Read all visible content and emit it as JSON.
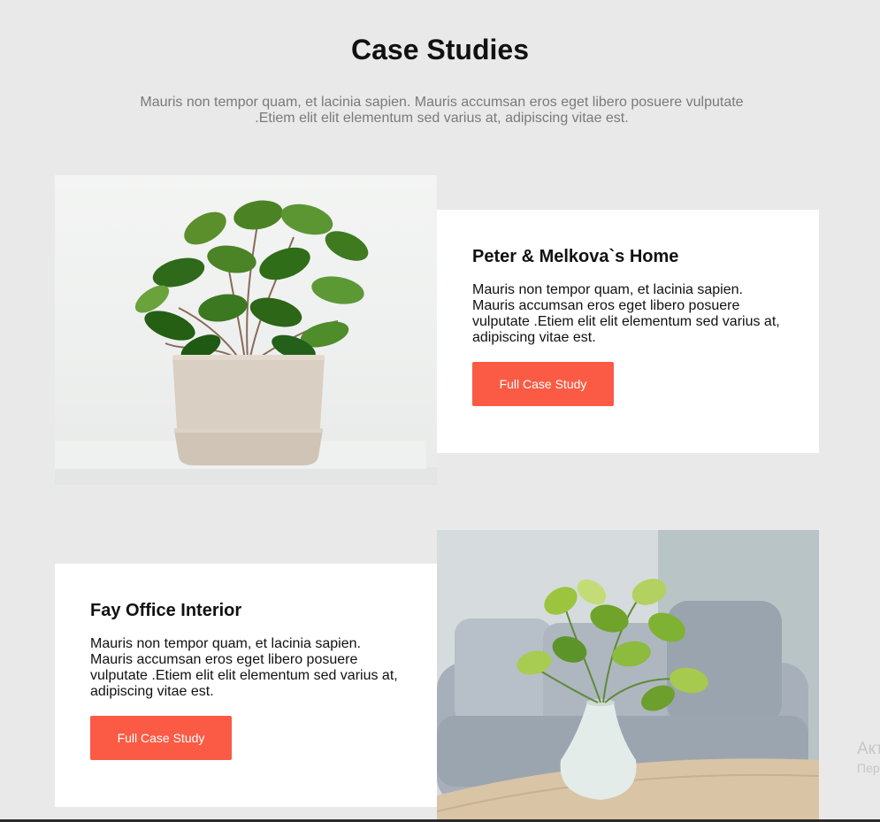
{
  "header": {
    "title": "Case Studies",
    "subtitle": "Mauris non tempor quam, et lacinia sapien. Mauris accumsan eros eget libero posuere vulputate .Etiem elit elit elementum sed varius at, adipiscing vitae est."
  },
  "cases": [
    {
      "title": "Peter & Melkova`s Home",
      "text": "Mauris non tempor quam, et lacinia sapien. Mauris accumsan eros eget libero posuere vulputate .Etiem elit elit elementum sed varius at, adipiscing vitae est.",
      "button_label": "Full Case Study"
    },
    {
      "title": "Fay Office Interior",
      "text": "Mauris non tempor quam, et lacinia sapien. Mauris accumsan eros eget libero posuere vulputate .Etiem elit elit elementum sed varius at, adipiscing vitae est.",
      "button_label": "Full Case Study"
    }
  ],
  "watermark": {
    "line1": "Акт",
    "line2": "Пер"
  },
  "colors": {
    "background": "#e9e9e9",
    "accent": "#fb5b44",
    "card": "#ffffff",
    "subtitle": "#7a7a7a"
  }
}
